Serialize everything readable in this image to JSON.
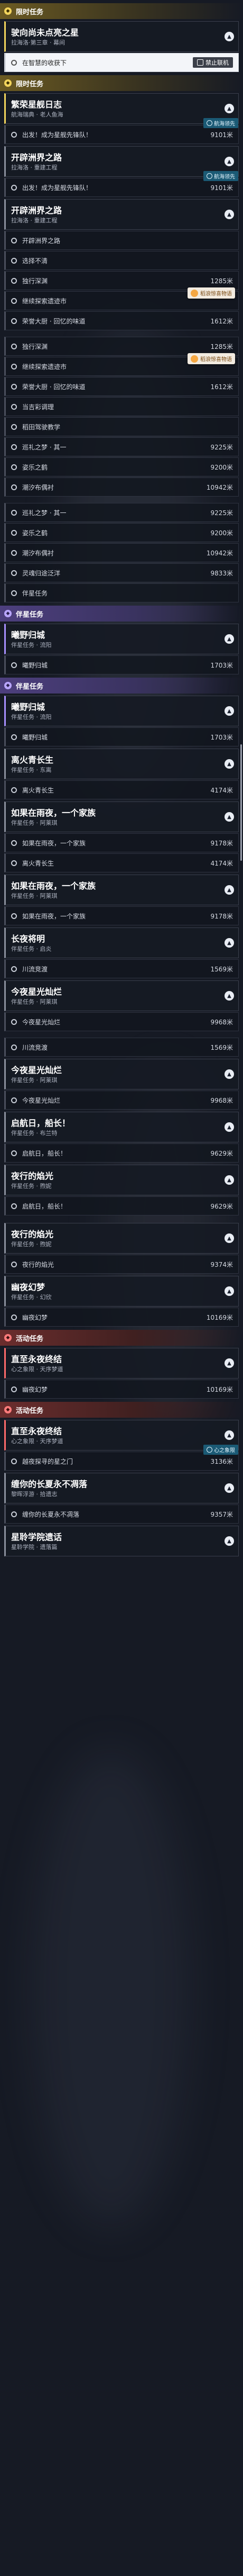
{
  "sections": [
    {
      "type": "header",
      "color": "yellow",
      "label": "限时任务"
    },
    {
      "type": "card",
      "style": "active",
      "title": "驶向尚未点亮之星",
      "sub": "拉海洛·第三章 · 幕间"
    },
    {
      "type": "obj",
      "text": "在智慧的收获下",
      "hl": true,
      "pill": "禁止联机",
      "dist": ""
    },
    {
      "type": "header",
      "color": "yellow",
      "label": "限时任务"
    },
    {
      "type": "card",
      "style": "active",
      "title": "繁荣星舰日志",
      "sub": "航海瑞典 · 老人鱼海"
    },
    {
      "type": "obj",
      "text": "出发！成为星舰先锋队！",
      "dist": "9101米",
      "badge": "航海领先"
    },
    {
      "type": "card",
      "style": "",
      "title": "开辟洲界之路",
      "sub": "拉海洛 · 重建工程"
    },
    {
      "type": "obj",
      "text": "出发！成为星舰先锋队！",
      "dist": "9101米",
      "badge": "航海领先"
    },
    {
      "type": "card",
      "style": "",
      "title": "开辟洲界之路",
      "sub": "拉海洛 · 重建工程"
    },
    {
      "type": "obj",
      "text": "开辟洲界之路",
      "dist": ""
    },
    {
      "type": "obj",
      "text": "选择不清",
      "dist": ""
    },
    {
      "type": "obj",
      "text": "独行深渊",
      "dist": "1285米"
    },
    {
      "type": "obj",
      "text": "继续探索遗迹市",
      "dist": "",
      "popup": "稻浪惊喜物语"
    },
    {
      "type": "obj",
      "text": "荣誉大厨 · 回忆的味道",
      "dist": "1612米"
    },
    {
      "type": "gap"
    },
    {
      "type": "obj",
      "text": "独行深渊",
      "dist": "1285米"
    },
    {
      "type": "obj",
      "text": "继续探索遗迹市",
      "dist": "",
      "popup": "稻浪惊喜物语"
    },
    {
      "type": "obj",
      "text": "荣誉大厨 · 回忆的味道",
      "dist": "1612米"
    },
    {
      "type": "obj",
      "text": "当吉彩调理",
      "dist": ""
    },
    {
      "type": "obj",
      "text": "稻田驾驶教学",
      "dist": ""
    },
    {
      "type": "obj",
      "text": "巡礼之梦 · 其一",
      "dist": "9225米"
    },
    {
      "type": "obj",
      "text": "姿乐之鹤",
      "dist": "9200米"
    },
    {
      "type": "obj",
      "text": "潮汐布偶衬",
      "dist": "10942米"
    },
    {
      "type": "gap"
    },
    {
      "type": "obj",
      "text": "巡礼之梦 · 其一",
      "dist": "9225米"
    },
    {
      "type": "obj",
      "text": "姿乐之鹤",
      "dist": "9200米"
    },
    {
      "type": "obj",
      "text": "潮汐布偶衬",
      "dist": "10942米"
    },
    {
      "type": "obj",
      "text": "灵魂归途泛洋",
      "dist": "9833米"
    },
    {
      "type": "obj",
      "text": "伴星任务",
      "dist": ""
    },
    {
      "type": "header",
      "color": "purple",
      "label": "伴星任务"
    },
    {
      "type": "card",
      "style": "purplec",
      "title": "曦野归城",
      "sub": "伴星任务 · 流阳"
    },
    {
      "type": "obj",
      "text": "曦野归城",
      "dist": "1703米"
    },
    {
      "type": "header",
      "color": "purple",
      "label": "伴星任务"
    },
    {
      "type": "card",
      "style": "purplec",
      "title": "曦野归城",
      "sub": "伴星任务 · 流阳"
    },
    {
      "type": "obj",
      "text": "曦野归城",
      "dist": "1703米"
    },
    {
      "type": "card",
      "style": "",
      "title": "离火青长生",
      "sub": "伴星任务 · 东离"
    },
    {
      "type": "obj",
      "text": "离火青长生",
      "dist": "4174米"
    },
    {
      "type": "card",
      "style": "",
      "title": "如果在雨夜，一个家族",
      "sub": "伴星任务 · 阿莱琪"
    },
    {
      "type": "obj",
      "text": "如果在雨夜，一个家族",
      "dist": "9178米"
    },
    {
      "type": "obj",
      "text": "离火青长生",
      "dist": "4174米"
    },
    {
      "type": "card",
      "style": "",
      "title": "如果在雨夜，一个家族",
      "sub": "伴星任务 · 阿莱琪"
    },
    {
      "type": "obj",
      "text": "如果在雨夜，一个家族",
      "dist": "9178米"
    },
    {
      "type": "card",
      "style": "",
      "title": "长夜将明",
      "sub": "伴星任务 · 启炎"
    },
    {
      "type": "obj",
      "text": "川流竞渡",
      "dist": "1569米"
    },
    {
      "type": "card",
      "style": "",
      "title": "今夜星光灿烂",
      "sub": "伴星任务 · 阿莱琪"
    },
    {
      "type": "obj",
      "text": "今夜星光灿烂",
      "dist": "9968米"
    },
    {
      "type": "gap"
    },
    {
      "type": "obj",
      "text": "川流竞渡",
      "dist": "1569米"
    },
    {
      "type": "card",
      "style": "",
      "title": "今夜星光灿烂",
      "sub": "伴星任务 · 阿莱琪"
    },
    {
      "type": "obj",
      "text": "今夜星光灿烂",
      "dist": "9968米"
    },
    {
      "type": "card",
      "style": "",
      "title": "启航日，船长！",
      "sub": "伴星任务 · 布兰特"
    },
    {
      "type": "obj",
      "text": "启航日，船长！",
      "dist": "9629米"
    },
    {
      "type": "card",
      "style": "",
      "title": "夜行的焰光",
      "sub": "伴星任务 · 煦妮"
    },
    {
      "type": "obj",
      "text": "启航日，船长！",
      "dist": "9629米"
    },
    {
      "type": "gap"
    },
    {
      "type": "card",
      "style": "",
      "title": "夜行的焰光",
      "sub": "伴星任务 · 煦妮"
    },
    {
      "type": "obj",
      "text": "夜行的焰光",
      "dist": "9374米"
    },
    {
      "type": "card",
      "style": "",
      "title": "幽夜幻梦",
      "sub": "伴星任务 · 幻欣"
    },
    {
      "type": "obj",
      "text": "幽夜幻梦",
      "dist": "10169米"
    },
    {
      "type": "header",
      "color": "red",
      "label": "活动任务"
    },
    {
      "type": "card",
      "style": "redc",
      "title": "直至永夜终结",
      "sub": "心之象限 · 天序梦道"
    },
    {
      "type": "obj",
      "text": "幽夜幻梦",
      "dist": "10169米"
    },
    {
      "type": "header",
      "color": "red",
      "label": "活动任务"
    },
    {
      "type": "card",
      "style": "redc",
      "title": "直至永夜终结",
      "sub": "心之象限 · 天序梦道"
    },
    {
      "type": "obj",
      "text": "越夜探寻的星之门",
      "dist": "3136米",
      "badge": "心之象限"
    },
    {
      "type": "card",
      "style": "",
      "title": "缠你的长夏永不凋落",
      "sub": "黎晖浮游 · 拾遗志"
    },
    {
      "type": "obj",
      "text": "缠你的长夏永不凋落",
      "dist": "9357米"
    },
    {
      "type": "card",
      "style": "",
      "title": "星聆学院遗话",
      "sub": "星聆学院 · 遗落篇"
    }
  ],
  "icons": {
    "chevron": "chevron-up-icon",
    "ring": "objective-ring-icon"
  },
  "colors": {
    "yellow": "#f2d45c",
    "purple": "#a890ff",
    "red": "#ff6b6b"
  }
}
